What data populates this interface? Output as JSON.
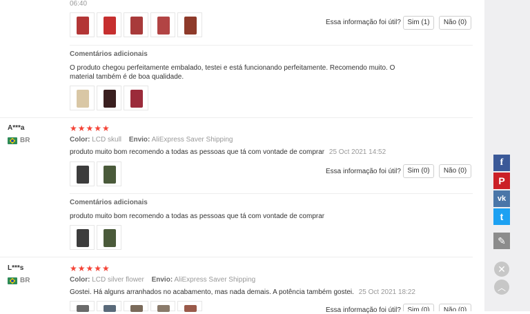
{
  "colors": {
    "star": "#f44336",
    "rightbar": "#efeff1",
    "facebook": "#3b5998",
    "pinterest": "#cb2027",
    "vk": "#4a76a8",
    "twitter": "#1da1f2",
    "edit": "#8c8c8c"
  },
  "review1": {
    "time": "06:40",
    "helpful_question": "Essa informação foi útil?",
    "yes_label": "Sim (1)",
    "no_label": "Não (0)",
    "additional_title": "Comentários adicionais",
    "additional_text_line1": "O produto chegou perfeitamente embalado, testei e está funcionando perfeitamente. Recomendo muito. O",
    "additional_text_line2": "material também é de boa qualidade."
  },
  "review2": {
    "user": "A***a",
    "country": "BR",
    "stars": "★★★★★",
    "color_label": "Color:",
    "color_value": "LCD skull",
    "shipping_label": "Envio:",
    "shipping_value": "AliExpress Saver Shipping",
    "text": "produto muito bom recomendo a todas as pessoas que tá com vontade de comprar",
    "date": "25 Oct 2021 14:52",
    "helpful_question": "Essa informação foi útil?",
    "yes_label": "Sim (0)",
    "no_label": "Não (0)",
    "additional_title": "Comentários adicionais",
    "additional_text": "produto muito bom recomendo a todas as pessoas que tá com vontade de comprar"
  },
  "review3": {
    "user": "L***s",
    "country": "BR",
    "stars": "★★★★★",
    "color_label": "Color:",
    "color_value": "LCD silver flower",
    "shipping_label": "Envio:",
    "shipping_value": "AliExpress Saver Shipping",
    "text": "Gostei. Há alguns arranhados no acabamento, mas nada demais. A potência também gostei.",
    "date": "25 Oct 2021 18:22",
    "helpful_question": "Essa informação foi útil?",
    "yes_label": "Sim (0)",
    "no_label": "Não (0)"
  },
  "sidebar": {
    "facebook_icon": "f",
    "pinterest_icon": "P",
    "vk_icon": "vk",
    "twitter_icon": "t",
    "edit_icon": "✎",
    "close_icon": "✕",
    "up_icon": "︿"
  }
}
